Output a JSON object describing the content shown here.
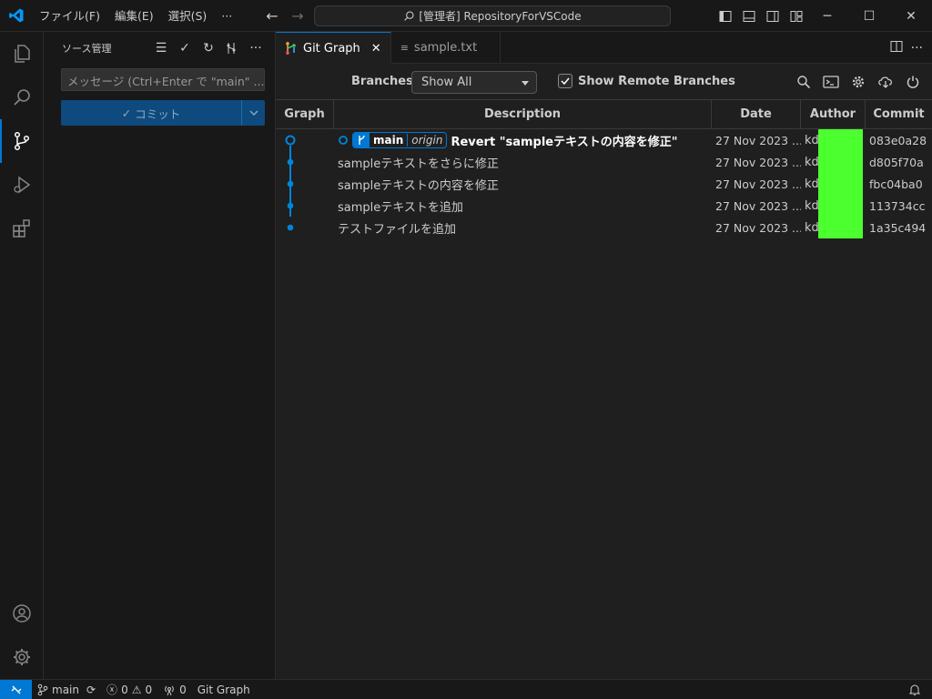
{
  "titlebar": {
    "menus": [
      "ファイル(F)",
      "編集(E)",
      "選択(S)",
      "···"
    ],
    "command_center": "[管理者] RepositoryForVSCode"
  },
  "sidebar": {
    "title": "ソース管理",
    "message_placeholder": "メッセージ (Ctrl+Enter で \"main\" ...",
    "commit_label": "コミット"
  },
  "tabs": [
    {
      "label": "Git Graph",
      "active": true
    },
    {
      "label": "sample.txt",
      "active": false
    }
  ],
  "git_graph": {
    "branches_label": "Branches:",
    "branches_value": "Show All",
    "show_remote_label": "Show Remote Branches",
    "show_remote_checked": true,
    "columns": [
      "Graph",
      "Description",
      "Date",
      "Author",
      "Commit"
    ],
    "head_ref": {
      "branch": "main",
      "remote": "origin"
    },
    "commits": [
      {
        "description": "Revert \"sampleテキストの内容を修正\"",
        "date": "27 Nov 2023 ...",
        "author": "kd",
        "hash": "083e0a28"
      },
      {
        "description": "sampleテキストをさらに修正",
        "date": "27 Nov 2023 ...",
        "author": "kd",
        "hash": "d805f70a"
      },
      {
        "description": "sampleテキストの内容を修正",
        "date": "27 Nov 2023 ...",
        "author": "kd",
        "hash": "fbc04ba0"
      },
      {
        "description": "sampleテキストを追加",
        "date": "27 Nov 2023 ...",
        "author": "kd",
        "hash": "113734cc"
      },
      {
        "description": "テストファイルを追加",
        "date": "27 Nov 2023 ...",
        "author": "kd",
        "hash": "1a35c494"
      }
    ]
  },
  "statusbar": {
    "branch": "main",
    "errors": "0",
    "warnings": "0",
    "ports": "0",
    "git_graph": "Git Graph"
  },
  "colors": {
    "accent": "#0078d4",
    "redaction": "#4cff2f"
  }
}
